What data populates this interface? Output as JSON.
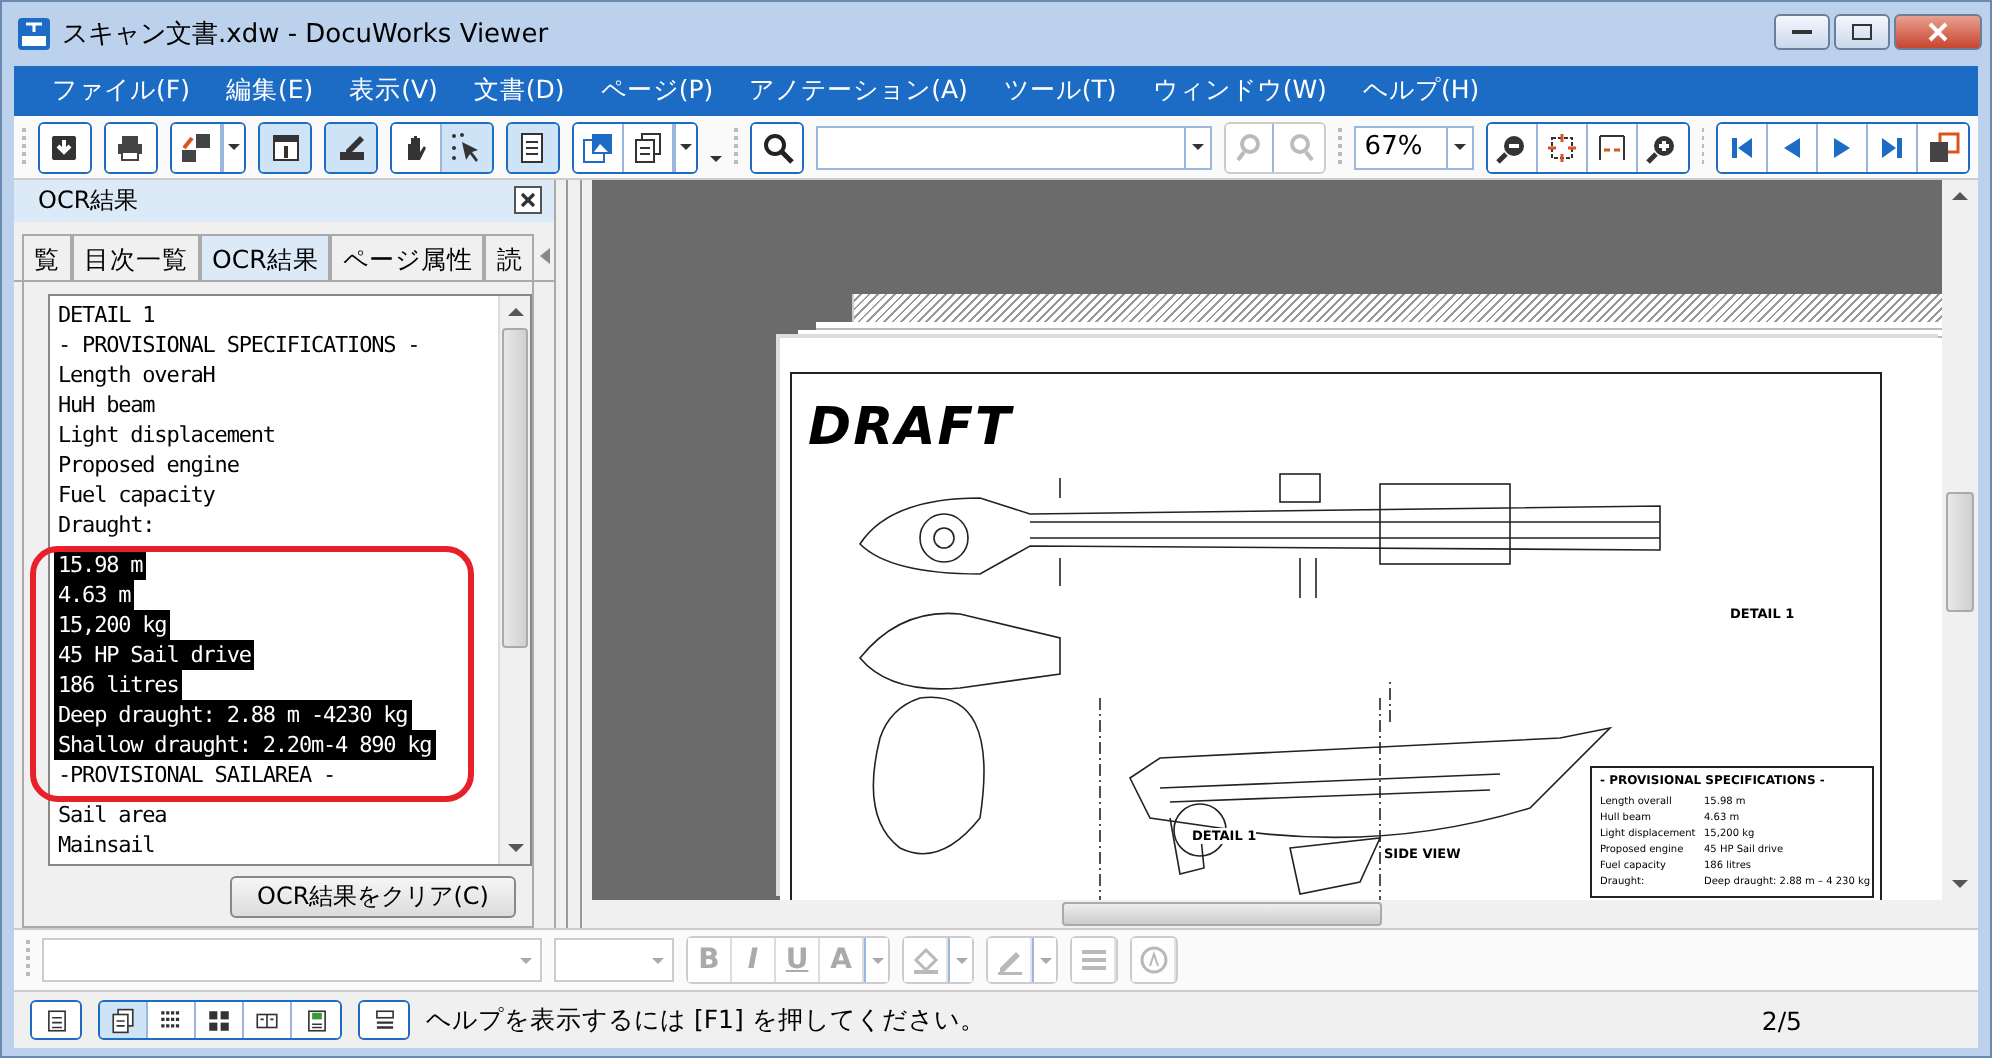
{
  "window": {
    "title": "スキャン文書.xdw - DocuWorks Viewer"
  },
  "menu": [
    "ファイル(F)",
    "編集(E)",
    "表示(V)",
    "文書(D)",
    "ページ(P)",
    "アノテーション(A)",
    "ツール(T)",
    "ウィンドウ(W)",
    "ヘルプ(H)"
  ],
  "toolbar": {
    "groups": [
      [
        {
          "kind": "save",
          "on": false,
          "disabled": false,
          "dropdown": false
        }
      ],
      [
        {
          "kind": "print",
          "on": false,
          "disabled": false,
          "dropdown": false
        }
      ],
      [
        {
          "kind": "convert",
          "on": false,
          "disabled": false,
          "dropdown": true
        }
      ],
      [
        {
          "kind": "info",
          "on": true,
          "disabled": false,
          "dropdown": false
        }
      ],
      [
        {
          "kind": "annotate",
          "on": true,
          "disabled": false,
          "dropdown": false
        }
      ],
      [
        {
          "kind": "hand",
          "on": false,
          "disabled": false,
          "dropdown": false
        },
        {
          "kind": "select",
          "on": true,
          "disabled": false,
          "dropdown": false
        }
      ],
      [
        {
          "kind": "text",
          "on": true,
          "disabled": false,
          "dropdown": false
        }
      ],
      [
        {
          "kind": "image",
          "on": false,
          "disabled": false,
          "dropdown": false
        },
        {
          "kind": "pages",
          "on": false,
          "disabled": false,
          "dropdown": true
        }
      ]
    ],
    "search_groups": [
      [
        {
          "kind": "search",
          "on": false,
          "disabled": false,
          "dropdown": false
        }
      ],
      [
        {
          "kind": "find-prev",
          "on": false,
          "disabled": true,
          "dropdown": false
        },
        {
          "kind": "find-next",
          "on": false,
          "disabled": true,
          "dropdown": false
        }
      ]
    ],
    "zoom": "67%",
    "view_groups": [
      [
        {
          "kind": "zoom-out",
          "on": false,
          "disabled": false,
          "dropdown": false
        },
        {
          "kind": "fit-page",
          "on": false,
          "disabled": false,
          "dropdown": false
        },
        {
          "kind": "fit-width",
          "on": false,
          "disabled": false,
          "dropdown": false
        },
        {
          "kind": "zoom-in",
          "on": false,
          "disabled": false,
          "dropdown": false
        }
      ],
      [
        {
          "kind": "first",
          "on": false,
          "disabled": false,
          "dropdown": false
        },
        {
          "kind": "prev",
          "on": false,
          "disabled": false,
          "dropdown": false
        },
        {
          "kind": "next",
          "on": false,
          "disabled": false,
          "dropdown": false
        },
        {
          "kind": "last",
          "on": false,
          "disabled": false,
          "dropdown": false
        },
        {
          "kind": "windows",
          "on": false,
          "disabled": false,
          "dropdown": false
        }
      ]
    ]
  },
  "panel": {
    "title": "OCR結果",
    "tabs": [
      {
        "label": "覧",
        "selected": false
      },
      {
        "label": "目次一覧",
        "selected": false
      },
      {
        "label": "OCR結果",
        "selected": true
      },
      {
        "label": "ページ属性",
        "selected": false
      },
      {
        "label": "読",
        "selected": false
      }
    ],
    "ocr_lines": [
      {
        "text": "DETAIL 1",
        "selected": false
      },
      {
        "text": "- PROVISIONAL SPECIFICATIONS -",
        "selected": false
      },
      {
        "text": "Length overaH",
        "selected": false
      },
      {
        "text": "HuH beam",
        "selected": false
      },
      {
        "text": "Light displacement",
        "selected": false
      },
      {
        "text": "Proposed engine",
        "selected": false
      },
      {
        "text": "Fuel capacity",
        "selected": false
      },
      {
        "text": "Draught:",
        "selected": false
      },
      {
        "text": "15.98 m",
        "selected": true
      },
      {
        "text": "4.63 m",
        "selected": true
      },
      {
        "text": "15,200 kg",
        "selected": true
      },
      {
        "text": "45 HP Sail drive",
        "selected": true
      },
      {
        "text": "186 litres",
        "selected": true
      },
      {
        "text": "Deep draught: 2.88 m -4230 kg",
        "selected": true
      },
      {
        "text": "Shallow draught: 2.20m-4 890 kg",
        "selected": true
      },
      {
        "text": "-PROVISIONAL SAILAREA -",
        "selected": false
      },
      {
        "text": "Sail area",
        "selected": false
      },
      {
        "text": "Mainsail",
        "selected": false
      }
    ],
    "clear_button": "OCR結果をクリア(C)"
  },
  "document": {
    "title": "DRAFT",
    "detail_label": "DETAIL 1",
    "detail_callout": "DETAIL 1",
    "side_view": "SIDE VIEW",
    "spec_title": "- PROVISIONAL SPECIFICATIONS -",
    "specs": [
      {
        "label": "Length overall",
        "value": "15.98 m"
      },
      {
        "label": "Hull beam",
        "value": "4.63 m"
      },
      {
        "label": "Light displacement",
        "value": "15,200 kg"
      },
      {
        "label": "Proposed engine",
        "value": "45 HP Sail drive"
      },
      {
        "label": "Fuel capacity",
        "value": "186 litres"
      },
      {
        "label": "Draught:",
        "value": "Deep draught: 2.88 m – 4 230 kg"
      }
    ]
  },
  "format_bar": {
    "letters": [
      {
        "label": "B",
        "disabled": true,
        "dropdown": false
      },
      {
        "label": "I",
        "disabled": true,
        "dropdown": false
      },
      {
        "label": "U",
        "disabled": true,
        "dropdown": false
      },
      {
        "label": "A",
        "disabled": true,
        "dropdown": true
      }
    ],
    "tools": [
      {
        "kind": "fill",
        "disabled": true,
        "dropdown": true
      },
      {
        "kind": "pen",
        "disabled": true,
        "dropdown": true
      },
      {
        "kind": "lines",
        "disabled": true,
        "dropdown": false
      },
      {
        "kind": "rotate",
        "disabled": true,
        "dropdown": false
      }
    ]
  },
  "status_bar": {
    "views": [
      [
        {
          "kind": "list",
          "selected": false
        }
      ],
      [
        {
          "kind": "pages",
          "selected": true
        },
        {
          "kind": "strips",
          "selected": false
        },
        {
          "kind": "grid",
          "selected": false
        },
        {
          "kind": "book",
          "selected": false
        },
        {
          "kind": "note",
          "selected": false
        }
      ],
      [
        {
          "kind": "layout",
          "selected": false
        }
      ]
    ],
    "message": "ヘルプを表示するには [F1] を押してください。",
    "page": "2/5"
  }
}
